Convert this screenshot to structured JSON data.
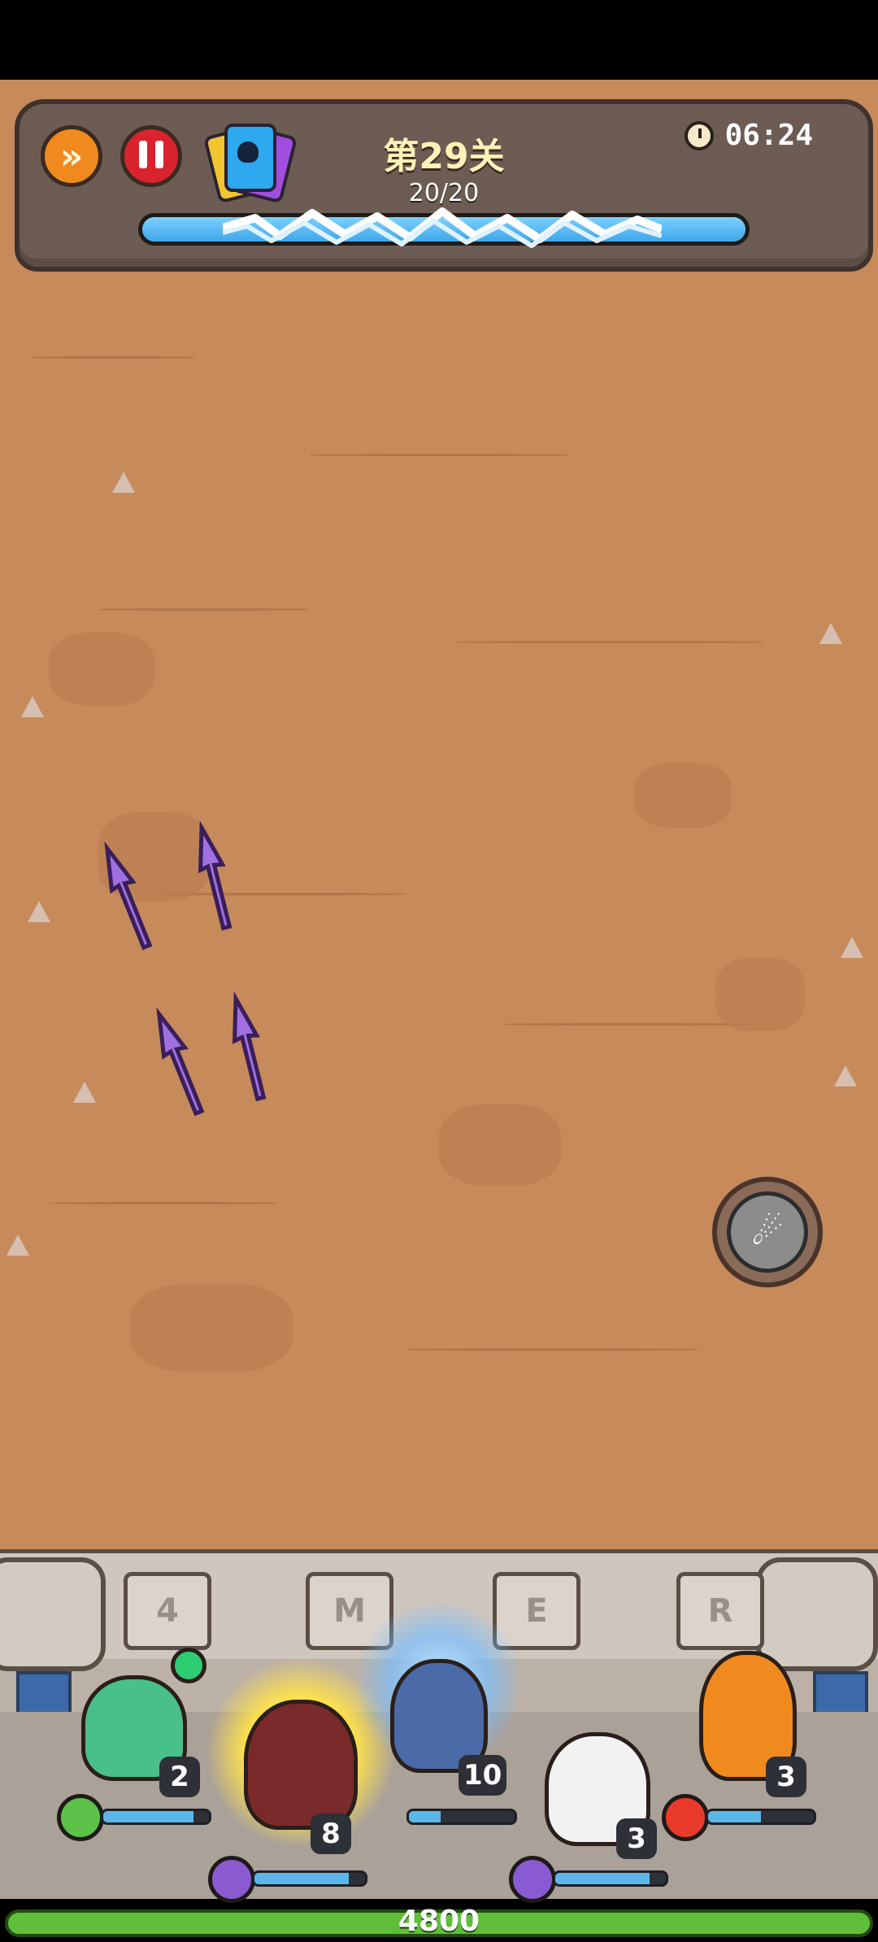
{
  "hud": {
    "level_title": "第29关",
    "wave_progress": "20/20",
    "wave_fraction": 1.0,
    "timer": "06:24",
    "icons": [
      "fast-forward-icon",
      "pause-icon",
      "card-deck-icon",
      "clock-icon"
    ]
  },
  "skill_button": {
    "icon": "wind-slash-icon"
  },
  "wall": {
    "stone_glyphs": [
      "4",
      "M",
      "E",
      "R"
    ]
  },
  "heroes": [
    {
      "name": "green-bird-hero",
      "level": "2",
      "hp_fraction": 0.85,
      "element": "wind",
      "color": "#49c08a"
    },
    {
      "name": "dark-mage-hero",
      "level": "8",
      "hp_fraction": 0.85,
      "element": "arcane",
      "color": "#7a2a2a"
    },
    {
      "name": "blue-elf-hero",
      "level": "10",
      "hp_fraction": 0.3,
      "element": "arcane",
      "color": "#4a6aa8"
    },
    {
      "name": "white-elder-hero",
      "level": "3",
      "hp_fraction": 0.85,
      "element": "arcane",
      "color": "#f2f2f2"
    },
    {
      "name": "fire-hero",
      "level": "3",
      "hp_fraction": 0.5,
      "element": "fire",
      "color": "#f08a1e"
    }
  ],
  "base": {
    "hp": "4800",
    "hp_fraction": 1.0
  },
  "colors": {
    "accent": "#f08a1e",
    "arrow": "#a070e0",
    "ground": "#c78a5a"
  }
}
